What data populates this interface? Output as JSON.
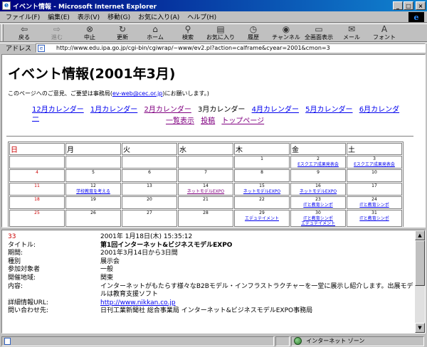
{
  "window": {
    "title": "イベント情報 - Microsoft Internet Explorer",
    "minimize": "_",
    "maximize": "□",
    "close": "×"
  },
  "menu": [
    "ファイル(F)",
    "編集(E)",
    "表示(V)",
    "移動(G)",
    "お気に入り(A)",
    "ヘルプ(H)"
  ],
  "toolbar": {
    "back": "戻る",
    "forward": "進む",
    "stop": "中止",
    "refresh": "更新",
    "home": "ホーム",
    "search": "検索",
    "favorites": "お気に入り",
    "history": "履歴",
    "channels": "チャンネル",
    "fullscreen": "全画面表示",
    "mail": "メール",
    "font": "フォント"
  },
  "address": {
    "label": "アドレス",
    "url": "http://www.edu.ipa.go.jp/cgi-bin/cgiwrap/~www/ev2.pl?action=calframe&cyear=2001&cmon=3"
  },
  "page": {
    "title": "イベント情報(2001年3月)",
    "contact_prefix": "このページへのご意見、ご要望は事務局(",
    "contact_email": "ev-web@cec.or.jp",
    "contact_suffix": ")にお願いします。)",
    "nav": {
      "dec": "12月カレンダー",
      "jan": "1月カレンダー",
      "feb": "2月カレンダー",
      "mar": "3月カレンダー",
      "apr": "4月カレンダー",
      "may": "5月カレンダー",
      "jun": "6月カレンダー"
    },
    "subnav": {
      "list": "一覧表示",
      "post": "投稿",
      "top": "トップページ"
    }
  },
  "calendar": {
    "headers": [
      "日",
      "月",
      "火",
      "水",
      "木",
      "金",
      "土"
    ],
    "weeks": [
      [
        {
          "d": ""
        },
        {
          "d": ""
        },
        {
          "d": ""
        },
        {
          "d": ""
        },
        {
          "d": "1"
        },
        {
          "d": "2",
          "ev": [
            "Eスクエア成果発表会"
          ]
        },
        {
          "d": "3",
          "ev": [
            "Eスクエア成果発表会"
          ]
        }
      ],
      [
        {
          "d": "4",
          "red": true
        },
        {
          "d": "5"
        },
        {
          "d": "6"
        },
        {
          "d": "7"
        },
        {
          "d": "8"
        },
        {
          "d": "9"
        },
        {
          "d": "10"
        }
      ],
      [
        {
          "d": "11",
          "red": true
        },
        {
          "d": "12",
          "ev": [
            "学校教育を考える"
          ]
        },
        {
          "d": "13"
        },
        {
          "d": "14",
          "ev": [
            "ネットモデルEXPO"
          ],
          "visited": true
        },
        {
          "d": "15",
          "ev": [
            "ネットモデルEXPO"
          ]
        },
        {
          "d": "16",
          "ev": [
            "ネットモデルEXPO"
          ]
        },
        {
          "d": "17"
        }
      ],
      [
        {
          "d": "18",
          "red": true
        },
        {
          "d": "19"
        },
        {
          "d": "20"
        },
        {
          "d": "21"
        },
        {
          "d": "22"
        },
        {
          "d": "23",
          "ev": [
            "ITと教育シンポ"
          ]
        },
        {
          "d": "24",
          "ev": [
            "ITと教育シンポ"
          ]
        }
      ],
      [
        {
          "d": "25",
          "red": true
        },
        {
          "d": "26"
        },
        {
          "d": "27"
        },
        {
          "d": "28"
        },
        {
          "d": "29",
          "ev": [
            "エデュテイメント"
          ]
        },
        {
          "d": "30",
          "ev": [
            "ITと教育シンポ",
            "エデュテイメント"
          ]
        },
        {
          "d": "31",
          "ev": [
            "ITと教育シンポ"
          ]
        }
      ]
    ]
  },
  "detail": {
    "id": "33",
    "posted": "2001年 1月18日(木) 15:35:12",
    "rows": [
      {
        "k": "タイトル:",
        "v": "第1回インターネット&ビジネスモデルEXPO",
        "bold": true
      },
      {
        "k": "期間:",
        "v": "2001年3月14日から3日間"
      },
      {
        "k": "種別",
        "v": "展示会"
      },
      {
        "k": "参加対象者",
        "v": "一般"
      },
      {
        "k": "開催地域:",
        "v": "関東"
      },
      {
        "k": "内容:",
        "v": "インターネットがもたらす様々なB2Bモデル・インフラストラクチャーを一堂に展示し紹介します。出展モデルは教育支援ソフト"
      }
    ],
    "url_label": "詳細情報URL:",
    "url": "http://www.nikkan.co.jp",
    "contact_label": "問い合わせ先:",
    "contact": "日刊工業新聞社 総合事業局 インターネット&ビジネスモデルEXPO事務局"
  },
  "status": {
    "zone": "インターネット ゾーン"
  }
}
